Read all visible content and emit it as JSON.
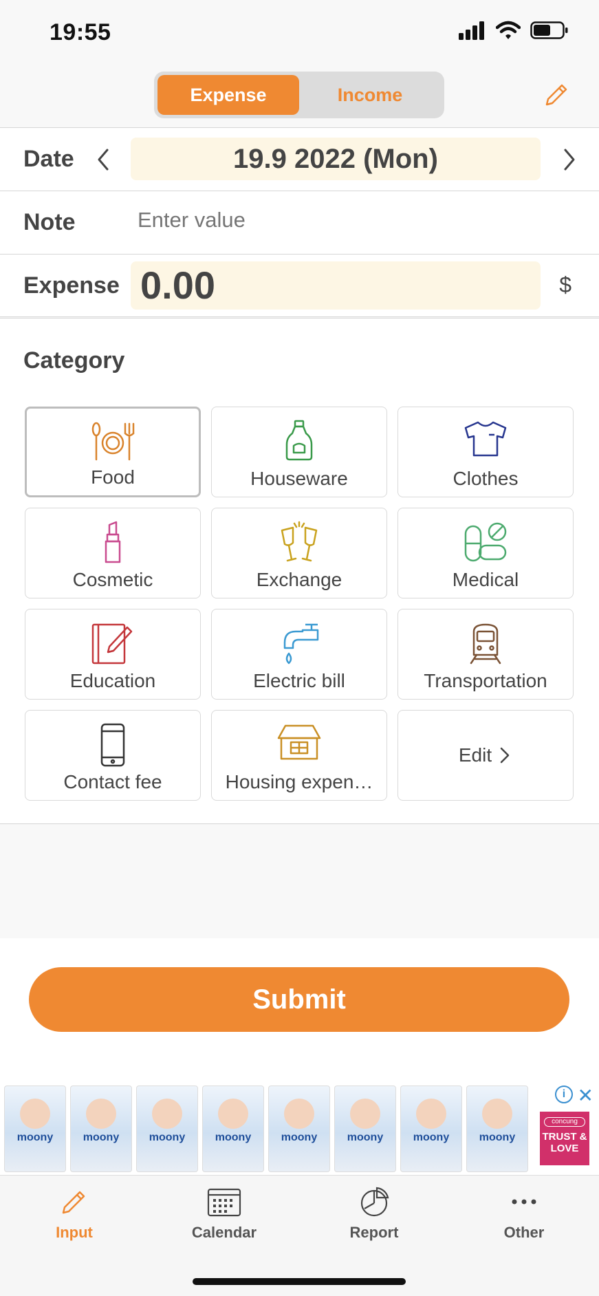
{
  "status_bar": {
    "time": "19:55"
  },
  "header": {
    "tabs": [
      "Expense",
      "Income"
    ],
    "active_tab": "Expense"
  },
  "form": {
    "date_label": "Date",
    "date_value": "19.9 2022 (Mon)",
    "note_label": "Note",
    "note_placeholder": "Enter value",
    "expense_label": "Expense",
    "expense_value": "0.00",
    "currency": "$"
  },
  "category": {
    "title": "Category",
    "items": [
      {
        "label": "Food",
        "icon": "food-icon",
        "color": "#d9832c"
      },
      {
        "label": "Houseware",
        "icon": "houseware-icon",
        "color": "#3a9a4a"
      },
      {
        "label": "Clothes",
        "icon": "clothes-icon",
        "color": "#27368f"
      },
      {
        "label": "Cosmetic",
        "icon": "lipstick-icon",
        "color": "#c94b8f"
      },
      {
        "label": "Exchange",
        "icon": "champagne-icon",
        "color": "#c9a21e"
      },
      {
        "label": "Medical",
        "icon": "pill-icon",
        "color": "#4caa6e"
      },
      {
        "label": "Education",
        "icon": "notebook-pencil-icon",
        "color": "#c4373b"
      },
      {
        "label": "Electric bill",
        "icon": "faucet-icon",
        "color": "#3b9ad2"
      },
      {
        "label": "Transportation",
        "icon": "train-icon",
        "color": "#7a5235"
      },
      {
        "label": "Contact fee",
        "icon": "phone-icon",
        "color": "#333333"
      },
      {
        "label": "Housing expen…",
        "icon": "house-icon",
        "color": "#c98f24"
      }
    ],
    "edit_label": "Edit"
  },
  "submit_label": "Submit",
  "ad": {
    "brand": "moony",
    "logo_top": "concung",
    "logo_text": "TRUST & LOVE"
  },
  "tabbar": {
    "items": [
      {
        "label": "Input",
        "icon": "pencil-icon"
      },
      {
        "label": "Calendar",
        "icon": "calendar-icon"
      },
      {
        "label": "Report",
        "icon": "pie-chart-icon"
      },
      {
        "label": "Other",
        "icon": "more-icon"
      }
    ],
    "active": "Input"
  },
  "colors": {
    "accent": "#ef8932",
    "field_bg": "#fdf6e4"
  }
}
